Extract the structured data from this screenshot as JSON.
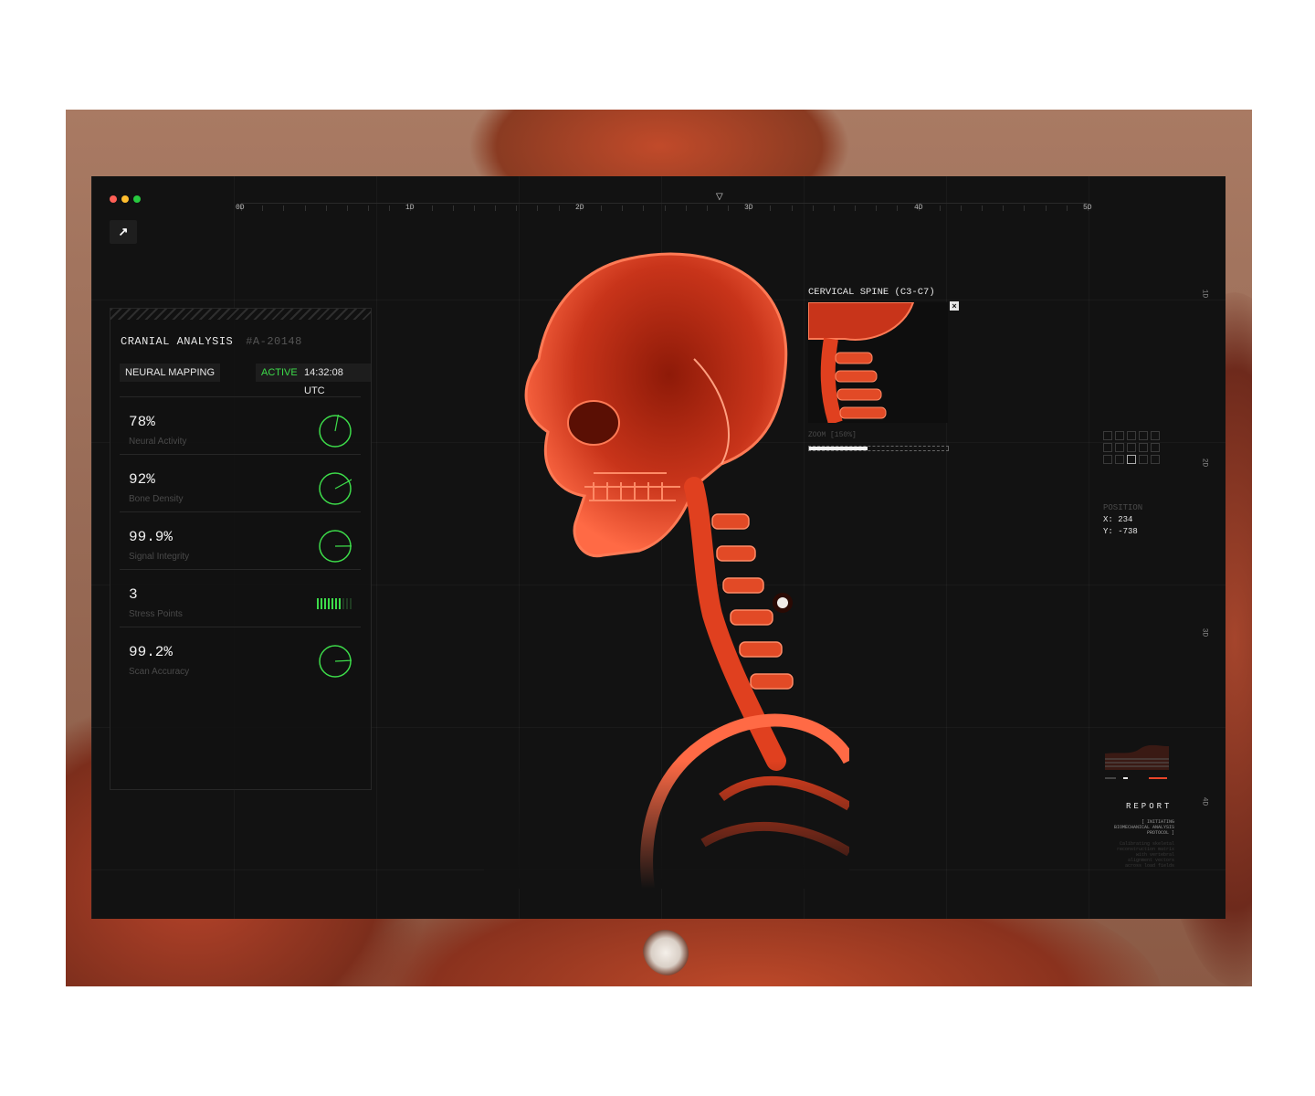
{
  "window": {
    "traffic_lights": [
      "#ff5f56",
      "#ffbd2e",
      "#27c93f"
    ],
    "logo_icon": "arrow-up-right-icon"
  },
  "ruler": {
    "labels": [
      "0D",
      "1D",
      "2D",
      "3D",
      "4D",
      "5D"
    ],
    "marker_icon": "triangle-down-icon"
  },
  "side_ruler": {
    "labels": [
      "1D",
      "2D",
      "3D",
      "4D"
    ]
  },
  "panel": {
    "title": "CRANIAL ANALYSIS",
    "id": "#A-20148",
    "mode": "NEURAL MAPPING",
    "status": "ACTIVE",
    "time": "14:32:08 UTC",
    "metrics": [
      {
        "value": "78%",
        "label": "Neural Activity",
        "level": 0.78,
        "indicator": "gauge"
      },
      {
        "value": "92%",
        "label": "Bone Density",
        "level": 0.92,
        "indicator": "gauge"
      },
      {
        "value": "99.9%",
        "label": "Signal Integrity",
        "level": 0.999,
        "indicator": "gauge"
      },
      {
        "value": "3",
        "label": "Stress Points",
        "level": 0.7,
        "indicator": "bars"
      },
      {
        "value": "99.2%",
        "label": "Scan Accuracy",
        "level": 0.992,
        "indicator": "gauge"
      }
    ]
  },
  "inset": {
    "title": "CERVICAL SPINE (C3-C7)",
    "close_icon": "close-icon",
    "zoom_label": "ZOOM [150%]",
    "zoom_level": 0.42
  },
  "position": {
    "label": "POSITION",
    "x": "X: 234",
    "y": "Y: -738"
  },
  "report": {
    "title": "REPORT",
    "lines": [
      "[ INITIATING",
      "BIOMECHANICAL ANALYSIS",
      "PROTOCOL ]"
    ],
    "faded_lines": [
      "Calibrating skeletal",
      "reconstruction matrix",
      "with vertebral",
      "alignment vectors",
      "across load fields"
    ]
  },
  "colors": {
    "accent_green": "#3ddc4a",
    "accent_red": "#e8452a",
    "panel_bg": "#121212"
  }
}
